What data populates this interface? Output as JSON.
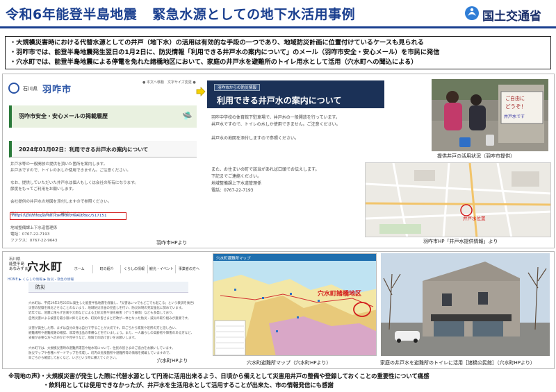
{
  "header": {
    "title_part1": "令和6年能登半島地震",
    "title_part2": "緊急水源としての地下水活用事例",
    "logo_text": "国土交通省"
  },
  "summary": {
    "lines": [
      "・大規模災害時における代替水源としての井戸（地下水）の活用は有効的な手段の一つであり、地域防災計画に位置付けているケースも見られる",
      "・羽咋市では、能登半島地震発生翌日の1月2日に、防災情報「利用できる井戸水の案内について」のメール（羽咋市安全・安心メール）を市民に発信",
      "・穴水町では、能登半島地震による停電を免れた諸橋地区において、家庭の井戸水を避難所のトイレ用水として活用（穴水町への聞込による）"
    ]
  },
  "hakui_site": {
    "pref": "石川県",
    "city": "羽咋市",
    "util": "● 本文へ移動　文字サイズ変更 ●",
    "band": "羽咋市安全・安心メールの掲載履歴",
    "date_heading": "2024年01月02日：利用できる井戸水の案内について",
    "body": [
      "井戸水等の一般開放の提供を頂いた箇所を案内します。",
      "井戸水ですので、トイレの水しか使用できません。ご注意ください。",
      "",
      "なお、提供していただいた井戸水は個人もしくは会社の所有になります。",
      "節度をもってご利用をお願いします。",
      "",
      "会社提供の井戸水の地図を添付しますので参照ください。",
      "",
      "添付ファイルはこちらからご確認ください。"
    ],
    "url": "https://plus.sugumail.com/usr/hakui/doc/517151",
    "footer": [
      "地域整備課上下水道管理係",
      "電話：0767-22-7193",
      "ファクス：0767-22-9643"
    ],
    "credit": "羽咋市HPより"
  },
  "notice": {
    "tag": "羽咋市からの防災情報",
    "title": "利用できる井戸水の案内について",
    "body": [
      "羽咋中学校の体育館下駐車場で、井戸水の一般開放を行っています。",
      "井戸水ですので、トイレの水しか使用できません。ご注意ください。",
      "",
      "井戸水の地図を添付しますので参照ください。"
    ],
    "contact": [
      "また、お住まいの町で該当があれば口頭でお伝えします。",
      "下記までご連絡ください。",
      "地域整備課上下水道管理係",
      "電話：0767-22-7193"
    ]
  },
  "photo_well": {
    "sign_text": [
      "ご自由に",
      "どうぞ！",
      "井戸水です"
    ],
    "caption": "提供井戸の活用状況（羽咋市提供）"
  },
  "hakui_map": {
    "label": "井戸水位置",
    "caption": "羽咋市HP「井戸水提供情報」より"
  },
  "anamizu_site": {
    "pref": [
      "石川県",
      "能登半島",
      "あなみずまち"
    ],
    "town": "穴水町",
    "nav": [
      "ホーム",
      "町の紹介",
      "くらしの情報",
      "観光・イベント",
      "事業者の方へ"
    ],
    "crumb": "HOME ▶ くらしの情報 ▶ 防災・救急の情報",
    "heading": "防災",
    "body": [
      "穴水町は、平成19年3月25日に発生した能登半島地震を経験し、「災害はいつでもどこでも起こる」という教訓を後世に伝えるため、",
      "災害の記憶を風化させることのないよう、地域防災計画の見直しを行い、防災体制の充実強化に努めています。",
      "近年では、地震に限らず台風や大雨などによる土砂災害や浸水被害（ゲリラ豪雨）なども多発しており、",
      "自然災害による被害を最小限に抑えるため、町民の皆さまと行政が一体となった防災・減災の取り組みが重要です。",
      "",
      "災害が発生した際、まずは自分の身は自分で守ることが大切です。日ごろから家族や近所の方と話し合い、",
      "避難場所や避難経路の確認、非常持出品の準備などを行いましょう。また、一人暮らしの高齢者や障害のある方など、",
      "支援が必要な方への声かけや見守りなど、地域での助け合いをお願いします。",
      "",
      "穴水町では、大規模災害時の避難所運営や給水等について、住民の皆さまのご協力をお願いしています。",
      "防災マップや各種ハザードマップを作成し、町内の危険箇所や避難所等の情報を掲載していますので、",
      "日ごろから確認しておくなど、いざという時に備えてください。"
    ],
    "credit": "穴水町HPより"
  },
  "hazard_map": {
    "title": "穴水町避難所マップ",
    "label": "穴水町諸橋地区",
    "caption": "穴水町避難所マップ（穴水町HPより）"
  },
  "photo_shelter": {
    "caption": "家庭の井戸水を避難所のトイレに活用［諸橋公民館］（穴水町HPより）"
  },
  "footer": {
    "lines": [
      "※現地の声》・大規模災害が発生した際に代替水源として円滑に活用出来るよう、日頃から備えとして災害用井戸の整備や登録しておくことの重要性について痛感",
      "・飲料用としては使用できなかったが、井戸水を生活用水として活用することが出来た、市の情報発信にも感謝"
    ]
  },
  "colors": {
    "title": "#1a3f8f",
    "url_highlight": "#d21a1a",
    "notice_band": "#1b3157",
    "map_label": "#d21a1a"
  }
}
